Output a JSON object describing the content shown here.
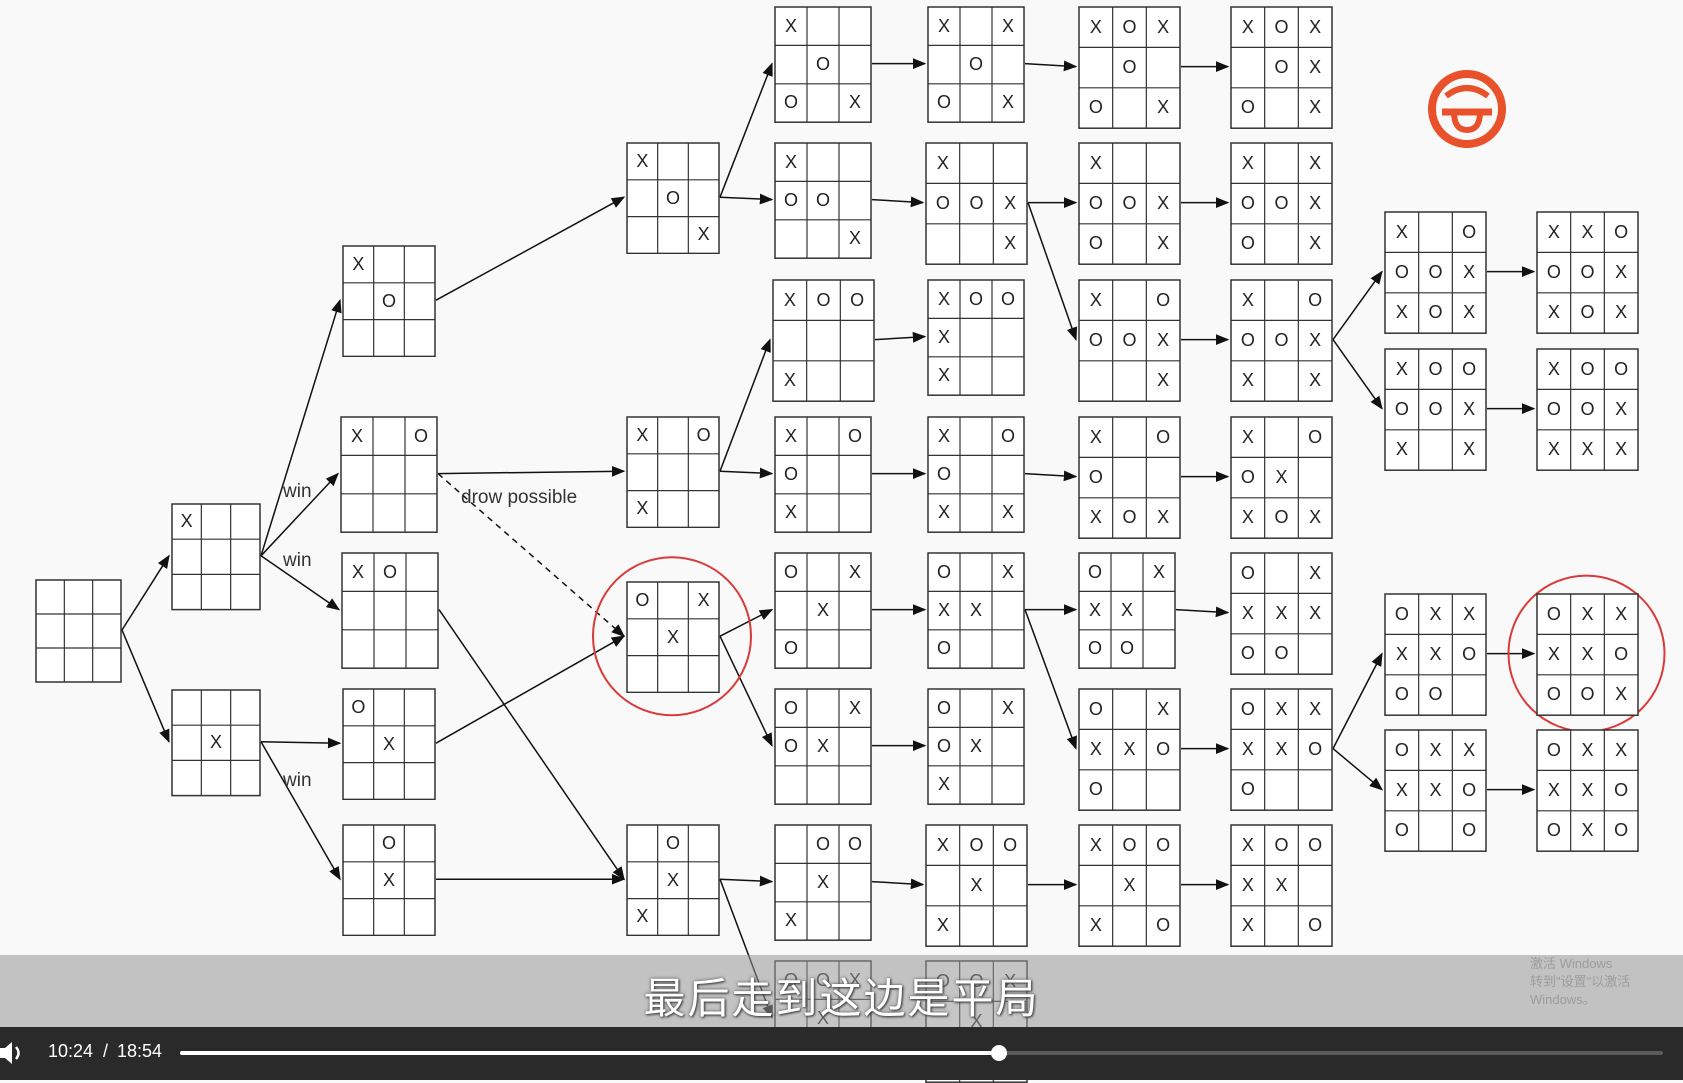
{
  "diagram": {
    "labels": {
      "win_1": "win",
      "win_2": "win",
      "win_3": "win",
      "draw_possible": "drow possible"
    },
    "boards": [
      {
        "id": "root",
        "cells": [
          "",
          "",
          "",
          "",
          "",
          "",
          "",
          "",
          ""
        ]
      },
      {
        "id": "b1a",
        "cells": [
          "X",
          "",
          "",
          "",
          "",
          "",
          "",
          "",
          ""
        ]
      },
      {
        "id": "b1b",
        "cells": [
          "",
          "",
          "",
          "",
          "X",
          "",
          "",
          "",
          ""
        ]
      },
      {
        "id": "b2a",
        "cells": [
          "X",
          "",
          "",
          "",
          "O",
          "",
          "",
          "",
          ""
        ]
      },
      {
        "id": "b2b",
        "cells": [
          "X",
          "",
          "O",
          "",
          "",
          "",
          "",
          "",
          ""
        ]
      },
      {
        "id": "b2c",
        "cells": [
          "X",
          "O",
          "",
          "",
          "",
          "",
          "",
          "",
          ""
        ]
      },
      {
        "id": "b2d",
        "cells": [
          "O",
          "",
          "",
          "",
          "X",
          "",
          "",
          "",
          ""
        ]
      },
      {
        "id": "b2e",
        "cells": [
          "",
          "O",
          "",
          "",
          "X",
          "",
          "",
          "",
          ""
        ]
      },
      {
        "id": "b3a",
        "cells": [
          "X",
          "",
          "",
          "",
          "O",
          "",
          "",
          "",
          "X"
        ]
      },
      {
        "id": "b3b",
        "cells": [
          "X",
          "",
          "O",
          "",
          "",
          "",
          "X",
          "",
          ""
        ]
      },
      {
        "id": "b3c",
        "cells": [
          "O",
          "",
          "X",
          "",
          "X",
          "",
          "",
          "",
          ""
        ]
      },
      {
        "id": "b3d",
        "cells": [
          "",
          "O",
          "",
          "",
          "X",
          "",
          "X",
          "",
          ""
        ]
      },
      {
        "id": "c1",
        "cells": [
          "X",
          "",
          "",
          "",
          "O",
          "",
          "O",
          "",
          "X"
        ]
      },
      {
        "id": "c2",
        "cells": [
          "X",
          "",
          "",
          "O",
          "O",
          "",
          "",
          "",
          "X"
        ]
      },
      {
        "id": "c3",
        "cells": [
          "X",
          "O",
          "O",
          "",
          "",
          "",
          "X",
          "",
          ""
        ]
      },
      {
        "id": "c4",
        "cells": [
          "X",
          "",
          "O",
          "O",
          "",
          "",
          "X",
          "",
          ""
        ]
      },
      {
        "id": "c5",
        "cells": [
          "O",
          "",
          "X",
          "",
          "X",
          "",
          "O",
          "",
          ""
        ]
      },
      {
        "id": "c6",
        "cells": [
          "O",
          "",
          "X",
          "O",
          "X",
          "",
          "",
          "",
          ""
        ]
      },
      {
        "id": "c7",
        "cells": [
          "",
          "O",
          "O",
          "",
          "X",
          "",
          "X",
          "",
          ""
        ]
      },
      {
        "id": "c8",
        "cells": [
          "O",
          "O",
          "X",
          "",
          "X",
          "",
          "X",
          "",
          ""
        ]
      },
      {
        "id": "d1",
        "cells": [
          "X",
          "",
          "X",
          "",
          "O",
          "",
          "O",
          "",
          "X"
        ]
      },
      {
        "id": "d2",
        "cells": [
          "X",
          "",
          "",
          "O",
          "O",
          "X",
          "",
          "",
          "X"
        ]
      },
      {
        "id": "d3",
        "cells": [
          "X",
          "O",
          "O",
          "X",
          "",
          "",
          "X",
          "",
          ""
        ]
      },
      {
        "id": "d4",
        "cells": [
          "X",
          "",
          "O",
          "O",
          "",
          "",
          "X",
          "",
          "X"
        ]
      },
      {
        "id": "d5",
        "cells": [
          "O",
          "",
          "X",
          "X",
          "X",
          "",
          "O",
          "",
          ""
        ]
      },
      {
        "id": "d6",
        "cells": [
          "O",
          "",
          "X",
          "O",
          "X",
          "",
          "X",
          "",
          ""
        ]
      },
      {
        "id": "d7",
        "cells": [
          "X",
          "O",
          "O",
          "",
          "X",
          "",
          "X",
          "",
          ""
        ]
      },
      {
        "id": "d8",
        "cells": [
          "O",
          "O",
          "X",
          "",
          "X",
          "",
          "X",
          "",
          ""
        ]
      },
      {
        "id": "e1",
        "cells": [
          "X",
          "O",
          "X",
          "",
          "O",
          "",
          "O",
          "",
          "X"
        ]
      },
      {
        "id": "e2",
        "cells": [
          "X",
          "",
          "",
          "O",
          "O",
          "X",
          "O",
          "",
          "X"
        ]
      },
      {
        "id": "e3",
        "cells": [
          "X",
          "",
          "O",
          "O",
          "O",
          "X",
          "",
          "",
          "X"
        ]
      },
      {
        "id": "e4",
        "cells": [
          "X",
          "",
          "O",
          "O",
          "",
          "",
          "X",
          "O",
          "X"
        ]
      },
      {
        "id": "e5",
        "cells": [
          "O",
          "",
          "X",
          "X",
          "X",
          "",
          "O",
          "O",
          ""
        ]
      },
      {
        "id": "e6",
        "cells": [
          "O",
          "",
          "X",
          "X",
          "X",
          "O",
          "O",
          "",
          ""
        ]
      },
      {
        "id": "e7",
        "cells": [
          "X",
          "O",
          "O",
          "",
          "X",
          "",
          "X",
          "",
          "O"
        ]
      },
      {
        "id": "f1",
        "cells": [
          "X",
          "O",
          "X",
          "",
          "O",
          "X",
          "O",
          "",
          "X"
        ]
      },
      {
        "id": "f2",
        "cells": [
          "X",
          "",
          "X",
          "O",
          "O",
          "X",
          "O",
          "",
          "X"
        ]
      },
      {
        "id": "f3",
        "cells": [
          "X",
          "",
          "O",
          "O",
          "O",
          "X",
          "X",
          "",
          "X"
        ]
      },
      {
        "id": "f4",
        "cells": [
          "X",
          "",
          "O",
          "O",
          "X",
          "",
          "X",
          "O",
          "X"
        ]
      },
      {
        "id": "f5",
        "cells": [
          "O",
          "",
          "X",
          "X",
          "X",
          "X",
          "O",
          "O",
          ""
        ]
      },
      {
        "id": "f6",
        "cells": [
          "O",
          "X",
          "X",
          "X",
          "X",
          "O",
          "O",
          "",
          ""
        ]
      },
      {
        "id": "f7",
        "cells": [
          "X",
          "O",
          "O",
          "X",
          "X",
          "",
          "X",
          "",
          "O"
        ]
      },
      {
        "id": "g1",
        "cells": [
          "X",
          "",
          "O",
          "O",
          "O",
          "X",
          "X",
          "O",
          "X"
        ]
      },
      {
        "id": "g2",
        "cells": [
          "X",
          "O",
          "O",
          "O",
          "O",
          "X",
          "X",
          "",
          "X"
        ]
      },
      {
        "id": "g3",
        "cells": [
          "O",
          "X",
          "X",
          "X",
          "X",
          "O",
          "O",
          "O",
          ""
        ]
      },
      {
        "id": "g4",
        "cells": [
          "O",
          "X",
          "X",
          "X",
          "X",
          "O",
          "O",
          "",
          "O"
        ]
      },
      {
        "id": "h1",
        "cells": [
          "X",
          "X",
          "O",
          "O",
          "O",
          "X",
          "X",
          "O",
          "X"
        ]
      },
      {
        "id": "h2",
        "cells": [
          "X",
          "O",
          "O",
          "O",
          "O",
          "X",
          "X",
          "X",
          "X"
        ]
      },
      {
        "id": "h3",
        "cells": [
          "O",
          "X",
          "X",
          "X",
          "X",
          "O",
          "O",
          "O",
          "X"
        ]
      },
      {
        "id": "h4",
        "cells": [
          "O",
          "X",
          "X",
          "X",
          "X",
          "O",
          "O",
          "X",
          "O"
        ]
      },
      {
        "id": "p1",
        "cells": [
          "O",
          "O",
          "X",
          "",
          "X",
          "",
          "",
          "",
          ""
        ]
      },
      {
        "id": "p2",
        "cells": [
          "O",
          "O",
          "X",
          "",
          "X",
          "",
          "",
          "",
          ""
        ]
      }
    ]
  },
  "subtitle": "最后走到这边是平局",
  "watermark": {
    "line1": "激活 Windows",
    "line2": "转到\"设置\"以激活 Windows。"
  },
  "player": {
    "current_time": "10:24",
    "separator": "/",
    "total_time": "18:54",
    "progress_fraction": 0.552
  },
  "colors": {
    "logo": "#e8512a",
    "highlight_circle": "#d93a3a",
    "player_bg": "#2a2a2a"
  },
  "icons": {
    "volume": "volume-icon",
    "logo": "g-logo-icon"
  }
}
